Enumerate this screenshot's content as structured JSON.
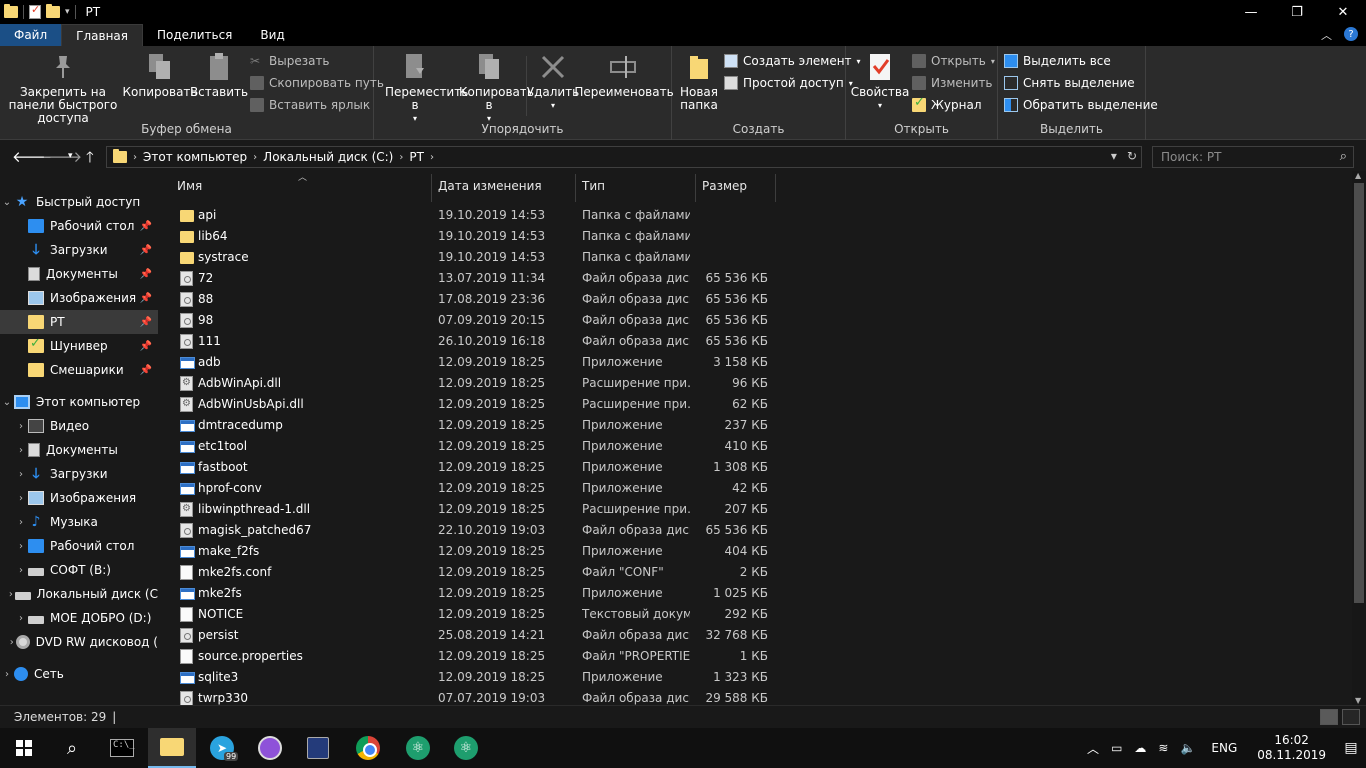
{
  "window": {
    "title": "PT",
    "controls": {
      "minimize": "—",
      "maximize": "❐",
      "close": "✕"
    }
  },
  "ribbon_tabs": {
    "file": "Файл",
    "home": "Главная",
    "share": "Поделиться",
    "view": "Вид"
  },
  "ribbon": {
    "clipboard": {
      "label": "Буфер обмена",
      "pin": "Закрепить на панели быстрого доступа",
      "copy": "Копировать",
      "paste": "Вставить",
      "cut": "Вырезать",
      "copy_path": "Скопировать путь",
      "paste_shortcut": "Вставить ярлык"
    },
    "organize": {
      "label": "Упорядочить",
      "move": "Переместить в",
      "copy_to": "Копировать в",
      "delete": "Удалить",
      "rename": "Переименовать"
    },
    "new": {
      "label": "Создать",
      "new_folder": "Новая папка",
      "new_item": "Создать элемент",
      "easy_access": "Простой доступ"
    },
    "open": {
      "label": "Открыть",
      "properties": "Свойства",
      "open": "Открыть",
      "edit": "Изменить",
      "history": "Журнал"
    },
    "select": {
      "label": "Выделить",
      "select_all": "Выделить все",
      "select_none": "Снять выделение",
      "invert": "Обратить выделение"
    }
  },
  "address": {
    "crumbs": [
      "Этот компьютер",
      "Локальный диск (C:)",
      "PT"
    ],
    "search_placeholder": "Поиск: PT"
  },
  "nav": {
    "quick_access": "Быстрый доступ",
    "quick_items": [
      {
        "label": "Рабочий стол",
        "icon": "desktop-icon"
      },
      {
        "label": "Загрузки",
        "icon": "downloads-icon"
      },
      {
        "label": "Документы",
        "icon": "documents-icon"
      },
      {
        "label": "Изображения",
        "icon": "pictures-icon"
      },
      {
        "label": "PT",
        "icon": "folder-icon"
      },
      {
        "label": "Шунивер",
        "icon": "folder-check-icon"
      },
      {
        "label": "Смешарики",
        "icon": "folder-icon"
      }
    ],
    "this_pc": "Этот компьютер",
    "pc_items": [
      {
        "label": "Видео",
        "icon": "video-icon"
      },
      {
        "label": "Документы",
        "icon": "documents-icon"
      },
      {
        "label": "Загрузки",
        "icon": "downloads-icon"
      },
      {
        "label": "Изображения",
        "icon": "pictures-icon"
      },
      {
        "label": "Музыка",
        "icon": "music-icon"
      },
      {
        "label": "Рабочий стол",
        "icon": "desktop-icon"
      },
      {
        "label": "СОФТ (B:)",
        "icon": "drive-icon"
      },
      {
        "label": "Локальный диск (C",
        "icon": "drive-icon"
      },
      {
        "label": "МОЕ ДОБРО (D:)",
        "icon": "drive-icon"
      },
      {
        "label": "DVD RW дисковод (",
        "icon": "dvd-icon"
      }
    ],
    "network": "Сеть"
  },
  "columns": {
    "name": "Имя",
    "date": "Дата изменения",
    "type": "Тип",
    "size": "Размер"
  },
  "files": [
    {
      "name": "api",
      "date": "19.10.2019 14:53",
      "type": "Папка с файлами",
      "size": "",
      "kind": "folder"
    },
    {
      "name": "lib64",
      "date": "19.10.2019 14:53",
      "type": "Папка с файлами",
      "size": "",
      "kind": "folder"
    },
    {
      "name": "systrace",
      "date": "19.10.2019 14:53",
      "type": "Папка с файлами",
      "size": "",
      "kind": "folder"
    },
    {
      "name": "72",
      "date": "13.07.2019 11:34",
      "type": "Файл образа диска",
      "size": "65 536 КБ",
      "kind": "disk"
    },
    {
      "name": "88",
      "date": "17.08.2019 23:36",
      "type": "Файл образа диска",
      "size": "65 536 КБ",
      "kind": "disk"
    },
    {
      "name": "98",
      "date": "07.09.2019 20:15",
      "type": "Файл образа диска",
      "size": "65 536 КБ",
      "kind": "disk"
    },
    {
      "name": "111",
      "date": "26.10.2019 16:18",
      "type": "Файл образа диска",
      "size": "65 536 КБ",
      "kind": "disk"
    },
    {
      "name": "adb",
      "date": "12.09.2019 18:25",
      "type": "Приложение",
      "size": "3 158 КБ",
      "kind": "app"
    },
    {
      "name": "AdbWinApi.dll",
      "date": "12.09.2019 18:25",
      "type": "Расширение при...",
      "size": "96 КБ",
      "kind": "dll"
    },
    {
      "name": "AdbWinUsbApi.dll",
      "date": "12.09.2019 18:25",
      "type": "Расширение при...",
      "size": "62 КБ",
      "kind": "dll"
    },
    {
      "name": "dmtracedump",
      "date": "12.09.2019 18:25",
      "type": "Приложение",
      "size": "237 КБ",
      "kind": "app"
    },
    {
      "name": "etc1tool",
      "date": "12.09.2019 18:25",
      "type": "Приложение",
      "size": "410 КБ",
      "kind": "app"
    },
    {
      "name": "fastboot",
      "date": "12.09.2019 18:25",
      "type": "Приложение",
      "size": "1 308 КБ",
      "kind": "app"
    },
    {
      "name": "hprof-conv",
      "date": "12.09.2019 18:25",
      "type": "Приложение",
      "size": "42 КБ",
      "kind": "app"
    },
    {
      "name": "libwinpthread-1.dll",
      "date": "12.09.2019 18:25",
      "type": "Расширение при...",
      "size": "207 КБ",
      "kind": "dll"
    },
    {
      "name": "magisk_patched67",
      "date": "22.10.2019 19:03",
      "type": "Файл образа диска",
      "size": "65 536 КБ",
      "kind": "disk"
    },
    {
      "name": "make_f2fs",
      "date": "12.09.2019 18:25",
      "type": "Приложение",
      "size": "404 КБ",
      "kind": "app"
    },
    {
      "name": "mke2fs.conf",
      "date": "12.09.2019 18:25",
      "type": "Файл \"CONF\"",
      "size": "2 КБ",
      "kind": "doc"
    },
    {
      "name": "mke2fs",
      "date": "12.09.2019 18:25",
      "type": "Приложение",
      "size": "1 025 КБ",
      "kind": "app"
    },
    {
      "name": "NOTICE",
      "date": "12.09.2019 18:25",
      "type": "Текстовый докум...",
      "size": "292 КБ",
      "kind": "doc"
    },
    {
      "name": "persist",
      "date": "25.08.2019 14:21",
      "type": "Файл образа диска",
      "size": "32 768 КБ",
      "kind": "disk"
    },
    {
      "name": "source.properties",
      "date": "12.09.2019 18:25",
      "type": "Файл \"PROPERTIES\"",
      "size": "1 КБ",
      "kind": "doc"
    },
    {
      "name": "sqlite3",
      "date": "12.09.2019 18:25",
      "type": "Приложение",
      "size": "1 323 КБ",
      "kind": "app"
    },
    {
      "name": "twrp330",
      "date": "07.07.2019 19:03",
      "type": "Файл образа диска",
      "size": "29 588 КБ",
      "kind": "disk"
    }
  ],
  "status": {
    "items_count": "Элементов: 29"
  },
  "taskbar": {
    "telegram_badge": "99",
    "lang": "ENG",
    "time": "16:02",
    "date": "08.11.2019"
  }
}
